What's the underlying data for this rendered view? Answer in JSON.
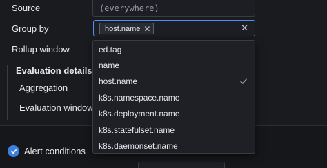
{
  "form": {
    "source_label": "Source",
    "source_value": "(everywhere)",
    "group_by_label": "Group by",
    "group_by_selected": "host.name",
    "rollup_label": "Rollup window",
    "evaluation_details_label": "Evaluation details",
    "aggregation_label": "Aggregation",
    "evaluation_window_label": "Evaluation window"
  },
  "dropdown": {
    "options": [
      {
        "label": "ed.tag",
        "selected": false
      },
      {
        "label": "name",
        "selected": false
      },
      {
        "label": "host.name",
        "selected": true
      },
      {
        "label": "k8s.namespace.name",
        "selected": false
      },
      {
        "label": "k8s.deployment.name",
        "selected": false
      },
      {
        "label": "k8s.statefulset.name",
        "selected": false
      },
      {
        "label": "k8s.daemonset.name",
        "selected": false
      }
    ]
  },
  "alert": {
    "title": "Alert conditions"
  },
  "icons": {
    "chip_remove": "close-icon",
    "clear": "close-icon",
    "selected": "checkmark-icon",
    "alert": "check-circle-icon"
  },
  "colors": {
    "accent": "#4c8ff5",
    "background": "#1a1b1f",
    "dropdown_bg": "#1f2025"
  }
}
